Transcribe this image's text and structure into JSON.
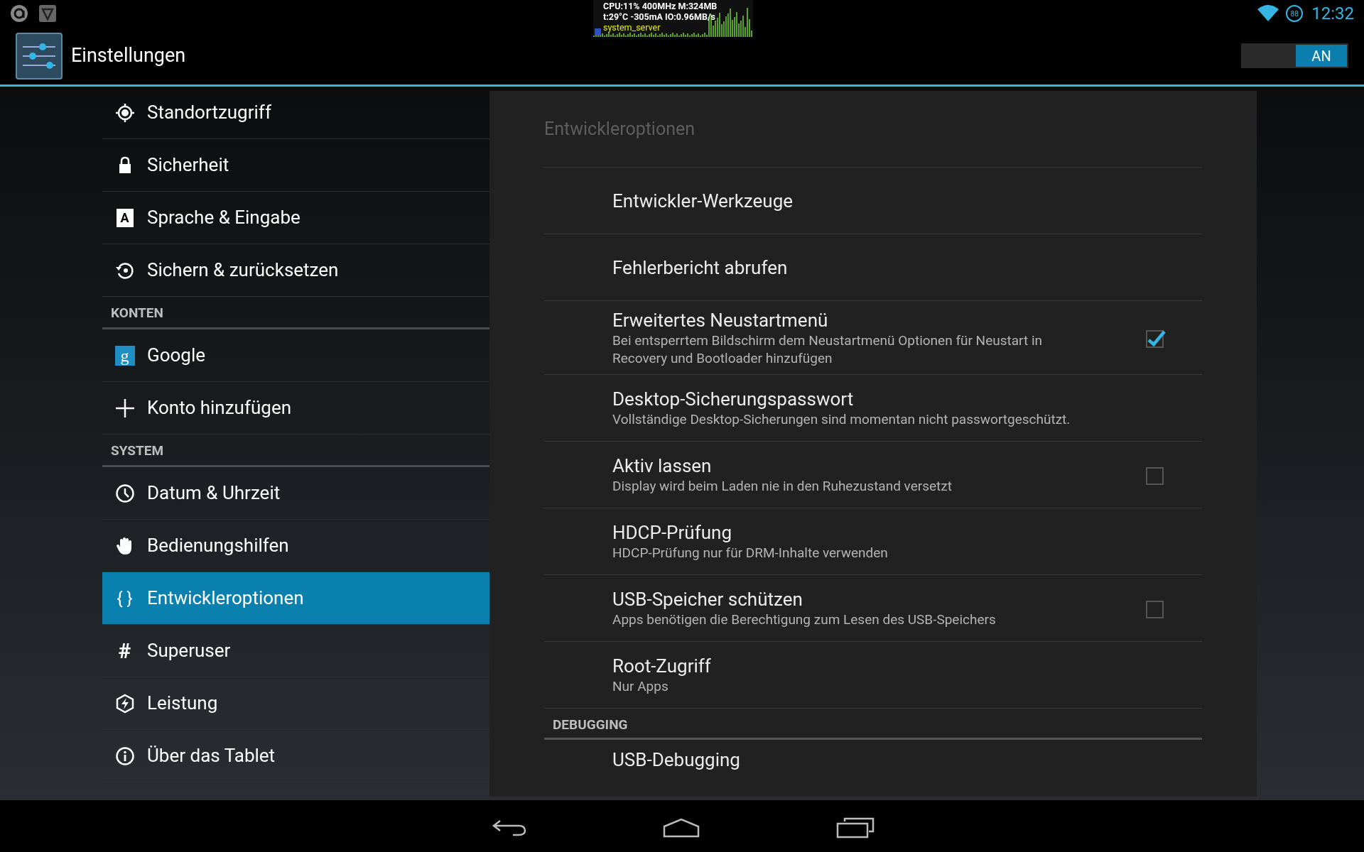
{
  "status_bar": {
    "cpu_overlay": {
      "lines": [
        "CPU:11% 400MHz M:324MB",
        "t:29°C -305mA IO:0.96MB/s"
      ],
      "process": "system_server"
    },
    "battery": "88",
    "time": "12:32"
  },
  "action_bar": {
    "title": "Einstellungen",
    "toggle": {
      "label": "AN",
      "on": true
    }
  },
  "sidebar": {
    "items": [
      {
        "kind": "item",
        "label": "Standortzugriff",
        "selected": false
      },
      {
        "kind": "item",
        "label": "Sicherheit",
        "selected": false
      },
      {
        "kind": "item",
        "label": "Sprache & Eingabe",
        "selected": false,
        "glyph": "A"
      },
      {
        "kind": "item",
        "label": "Sichern & zurücksetzen",
        "selected": false
      },
      {
        "kind": "header",
        "label": "KONTEN"
      },
      {
        "kind": "item",
        "label": "Google",
        "selected": false,
        "glyph": "g"
      },
      {
        "kind": "item",
        "label": "Konto hinzufügen",
        "selected": false
      },
      {
        "kind": "header",
        "label": "SYSTEM"
      },
      {
        "kind": "item",
        "label": "Datum & Uhrzeit",
        "selected": false
      },
      {
        "kind": "item",
        "label": "Bedienungshilfen",
        "selected": false
      },
      {
        "kind": "item",
        "label": "Entwickleroptionen",
        "selected": true,
        "glyph": "{ }"
      },
      {
        "kind": "item",
        "label": "Superuser",
        "selected": false,
        "glyph": "#"
      },
      {
        "kind": "item",
        "label": "Leistung",
        "selected": false
      },
      {
        "kind": "item",
        "label": "Über das Tablet",
        "selected": false
      }
    ]
  },
  "panel": {
    "title": "Entwickleroptionen",
    "rows": [
      {
        "kind": "pref",
        "title": "Entwickler-Werkzeuge"
      },
      {
        "kind": "pref",
        "title": "Fehlerbericht abrufen"
      },
      {
        "kind": "checkbox",
        "title": "Erweitertes Neustartmenü",
        "summary": "Bei entsperrtem Bildschirm dem Neustartmenü Optionen für Neustart in Recovery und Bootloader hinzufügen",
        "checked": true
      },
      {
        "kind": "pref",
        "title": "Desktop-Sicherungspasswort",
        "summary": "Vollständige Desktop-Sicherungen sind momentan nicht passwortgeschützt."
      },
      {
        "kind": "checkbox",
        "title": "Aktiv lassen",
        "summary": "Display wird beim Laden nie in den Ruhezustand versetzt",
        "checked": false
      },
      {
        "kind": "pref",
        "title": "HDCP-Prüfung",
        "summary": "HDCP-Prüfung nur für DRM-Inhalte verwenden"
      },
      {
        "kind": "checkbox",
        "title": "USB-Speicher schützen",
        "summary": "Apps benötigen die Berechtigung zum Lesen des USB-Speichers",
        "checked": false
      },
      {
        "kind": "pref",
        "title": "Root-Zugriff",
        "summary": "Nur Apps"
      },
      {
        "kind": "header",
        "title": "DEBUGGING"
      },
      {
        "kind": "pref",
        "title": "USB-Debugging"
      }
    ]
  }
}
